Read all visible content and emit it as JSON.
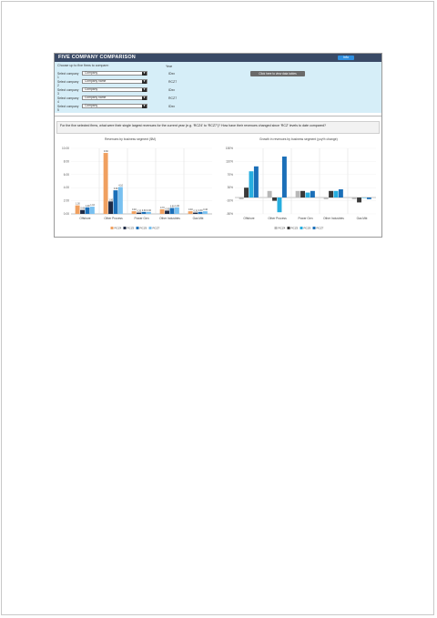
{
  "header": {
    "title": "FIVE COMPANY COMPARISON",
    "button_label": "Info"
  },
  "filters": {
    "intro": "Choose up to five firms to compare:",
    "year_header": "Year",
    "rows": [
      {
        "label": "Select company 1",
        "value": "Company",
        "code": "IDxx"
      },
      {
        "label": "Select company 2",
        "value": "Company name",
        "code": "RCZ7"
      },
      {
        "label": "Select company 3",
        "value": "Company",
        "code": "IDxx"
      },
      {
        "label": "Select company 4",
        "value": "Company name",
        "code": "RCZ7"
      },
      {
        "label": "Select company 5",
        "value": "Company",
        "code": "IDxx"
      }
    ],
    "go_button": "Click here to view data tables"
  },
  "question": "For the five selected firms, what were their single largest revenues for the current year (e.g. ‘RCZ4’ to ‘RCZ7’)? How have their revenues changed since ‘RCZ’ levels to date compared?",
  "charts": [
    {
      "title": "Revenues by business segment ($M)",
      "chart_data": {
        "type": "bar",
        "categories": [
          "Offshore",
          "Other Process",
          "Power Gen",
          "Other Industries",
          "Gas Mkt"
        ],
        "series": [
          {
            "name": "RCZ4",
            "values": [
              1.3,
              9.3,
              0.4,
              0.7,
              0.4
            ],
            "color": "#f0a060"
          },
          {
            "name": "RCZ5",
            "values": [
              0.6,
              1.9,
              0.2,
              0.5,
              0.2
            ],
            "color": "#1f2a44"
          },
          {
            "name": "RCZ6",
            "values": [
              1.0,
              3.6,
              0.3,
              0.9,
              0.3
            ],
            "color": "#1b6fb8"
          },
          {
            "name": "RCZ7",
            "values": [
              1.1,
              4.1,
              0.3,
              1.0,
              0.4
            ],
            "color": "#78c0f0"
          }
        ],
        "ylim": [
          0,
          10
        ],
        "yticks": [
          "0.00",
          "2.00",
          "4.00",
          "6.00",
          "8.00",
          "10.00"
        ]
      }
    },
    {
      "title": "Growth in revenues by business segment (yoy% change)",
      "chart_data": {
        "type": "bar",
        "categories": [
          "Offshore",
          "Other Process",
          "Power Gen",
          "Other Industries",
          "Gas Mkt"
        ],
        "series": [
          {
            "name": "RCZ4",
            "values": [
              -5,
              20,
              20,
              -5,
              -5
            ],
            "color": "#b8b8b8"
          },
          {
            "name": "RCZ5",
            "values": [
              30,
              -10,
              20,
              20,
              -15
            ],
            "color": "#3a3a3a"
          },
          {
            "name": "RCZ6",
            "values": [
              80,
              -45,
              15,
              20,
              0
            ],
            "color": "#27aedf"
          },
          {
            "name": "RCZ7",
            "values": [
              95,
              125,
              20,
              25,
              -5
            ],
            "color": "#1b6fb8"
          }
        ],
        "ylim": [
          -50,
          150
        ]
      }
    }
  ]
}
